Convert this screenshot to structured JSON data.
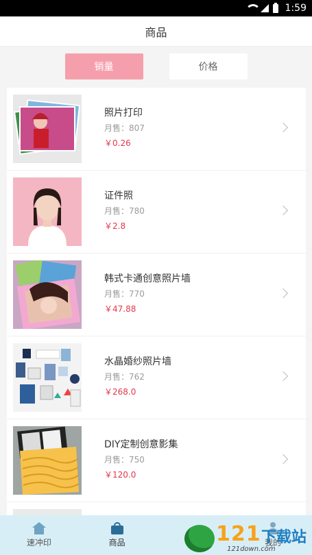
{
  "status_bar": {
    "time": "1:59"
  },
  "header": {
    "title": "商品"
  },
  "sort": {
    "sales_label": "销量",
    "price_label": "价格"
  },
  "products": [
    {
      "name": "照片打印",
      "sales": "月售：807",
      "price": "￥0.26"
    },
    {
      "name": "证件照",
      "sales": "月售：780",
      "price": "￥2.8"
    },
    {
      "name": "韩式卡通创意照片墙",
      "sales": "月售：770",
      "price": "￥47.88"
    },
    {
      "name": "水晶婚纱照片墙",
      "sales": "月售：762",
      "price": "￥268.0"
    },
    {
      "name": "DIY定制创意影集",
      "sales": "月售：750",
      "price": "￥120.0"
    }
  ],
  "bottom_nav": [
    {
      "label": "速冲印",
      "icon": "home-icon"
    },
    {
      "label": "商品",
      "icon": "shopping-bag-icon",
      "active": true
    },
    {
      "label": "",
      "icon": "camera-icon"
    },
    {
      "label": "我的",
      "icon": "user-icon"
    }
  ],
  "watermark": {
    "brand": "121",
    "cn": "下载站",
    "url": "121down.com"
  },
  "colors": {
    "accent": "#f69fac",
    "price": "#e3364a",
    "nav_bg": "#d8eef7"
  }
}
